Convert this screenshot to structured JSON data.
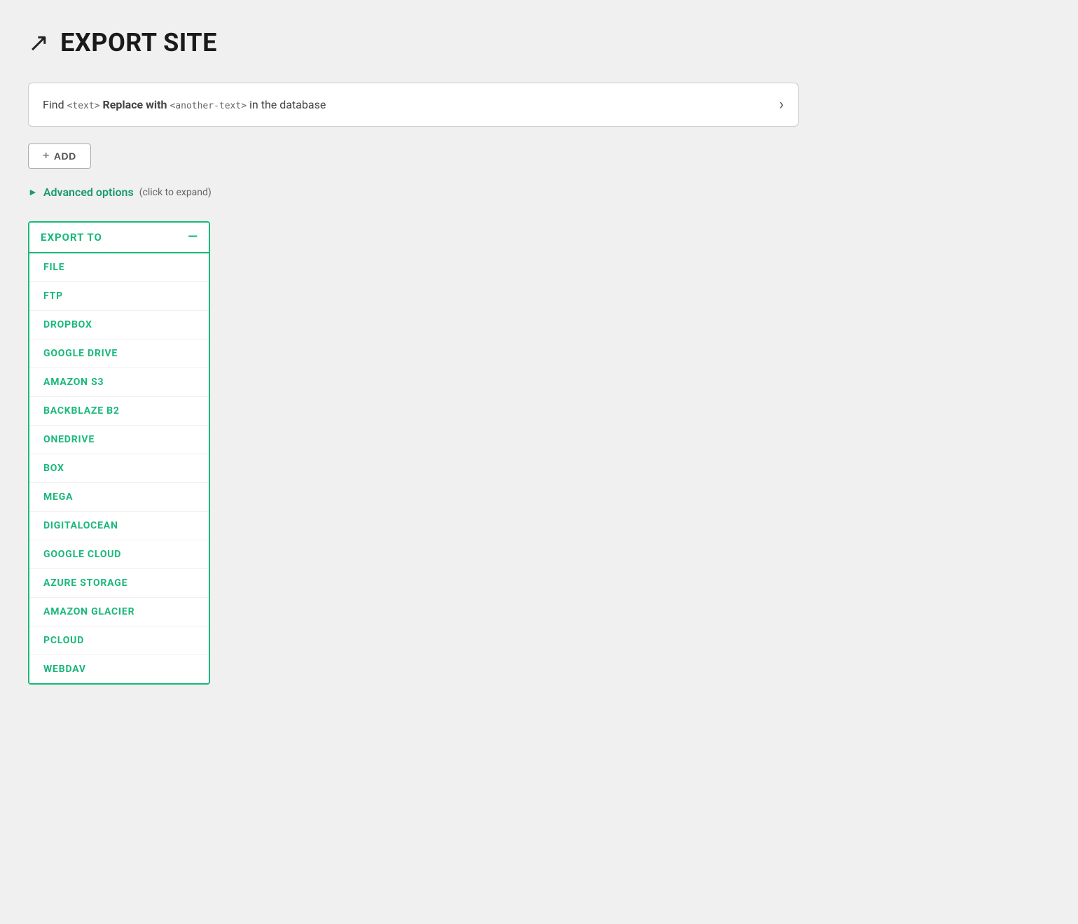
{
  "page": {
    "title": "EXPORT SITE"
  },
  "find_replace": {
    "label_find": "Find",
    "placeholder_find": "<text>",
    "label_replace": "Replace with",
    "placeholder_replace": "<another-text>",
    "label_suffix": "in the database"
  },
  "add_button": {
    "label": "ADD",
    "icon": "+"
  },
  "advanced_options": {
    "label": "Advanced options",
    "hint": "(click to expand)"
  },
  "export_panel": {
    "title": "EXPORT TO",
    "collapse_icon": "—",
    "items": [
      "FILE",
      "FTP",
      "DROPBOX",
      "GOOGLE DRIVE",
      "AMAZON S3",
      "BACKBLAZE B2",
      "ONEDRIVE",
      "BOX",
      "MEGA",
      "DIGITALOCEAN",
      "GOOGLE CLOUD",
      "AZURE STORAGE",
      "AMAZON GLACIER",
      "PCLOUD",
      "WEBDAV"
    ]
  }
}
